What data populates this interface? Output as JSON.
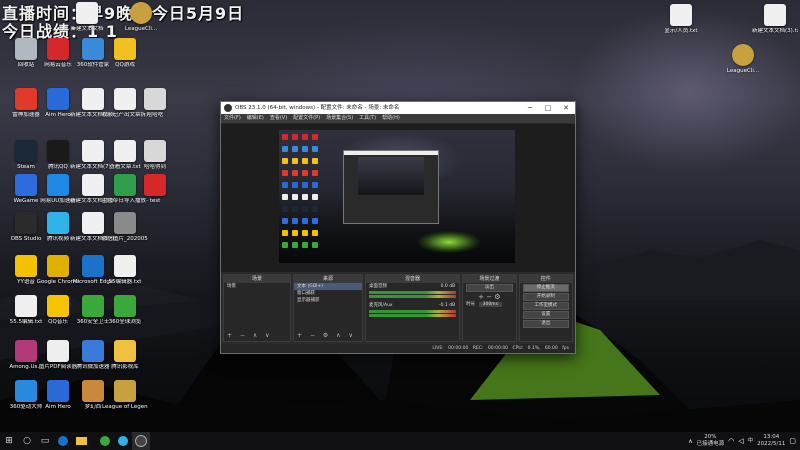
{
  "stream_overlay": {
    "line1": "直播时间：早9晚5  今日5月9日",
    "line2": "今日战绩：1 1"
  },
  "desktop_icons_left": [
    {
      "label": "回收站",
      "icon": "recycle-bin-icon",
      "color": "#b0b8c0"
    },
    {
      "label": "网易云音乐",
      "icon": "netease-music-icon",
      "color": "#d4282d"
    },
    {
      "label": "360软件管家",
      "icon": "360-software-icon",
      "color": "#3b8ad8"
    },
    {
      "label": "QQ游戏",
      "icon": "qq-game-icon",
      "color": "#f0c020"
    },
    {
      "label": "雷神加速器",
      "icon": "leishen-icon",
      "color": "#e23a2a"
    },
    {
      "label": "Aim Hero",
      "icon": "aim-hero-icon",
      "color": "#2a6ad8"
    },
    {
      "label": "新建文本文档(6).txt",
      "icon": "text-file-icon",
      "color": "#f0f0f0"
    },
    {
      "label": "视频已产出文章拆分.txt",
      "icon": "text-file-icon",
      "color": "#f0f0f0"
    },
    {
      "label": "哈哈吃",
      "icon": "app-icon",
      "color": "#d8d8d8"
    },
    {
      "label": "Steam",
      "icon": "steam-icon",
      "color": "#1b2838"
    },
    {
      "label": "腾讯QQ",
      "icon": "qq-icon",
      "color": "#1a1a1a"
    },
    {
      "label": "新建文本文档(7).txt",
      "icon": "text-file-icon",
      "color": "#f0f0f0"
    },
    {
      "label": "查看文章.txt",
      "icon": "text-file-icon",
      "color": "#f0f0f0"
    },
    {
      "label": "哈哈得到",
      "icon": "app-icon",
      "color": "#d8d8d8"
    },
    {
      "label": "WeGame",
      "icon": "wegame-icon",
      "color": "#2d6cdf"
    },
    {
      "label": "网易UU加速器",
      "icon": "uu-icon",
      "color": "#1e88e5"
    },
    {
      "label": "新建文本文档(8).txt",
      "icon": "text-file-icon",
      "color": "#f0f0f0"
    },
    {
      "label": "主播今日导入播放-360",
      "icon": "sheet-icon",
      "color": "#2e9e4a"
    },
    {
      "label": "test",
      "icon": "heart-icon",
      "color": "#d62828"
    },
    {
      "label": "OBS Studio",
      "icon": "obs-icon",
      "color": "#2b2b2b"
    },
    {
      "label": "腾讯视频",
      "icon": "tencent-video-icon",
      "color": "#2fb3e8"
    },
    {
      "label": "新建文本文档(5).txt",
      "icon": "text-file-icon",
      "color": "#f0f0f0"
    },
    {
      "label": "微信图片_2020051...",
      "icon": "image-file-icon",
      "color": "#8a8a8a"
    },
    {
      "label": "YY语音",
      "icon": "yy-icon",
      "color": "#f2c200"
    },
    {
      "label": "Google Chrome",
      "icon": "chrome-icon",
      "color": "#e0b000"
    },
    {
      "label": "Microsoft Edge",
      "icon": "edge-icon",
      "color": "#1a73c8"
    },
    {
      "label": "55编辑器.txt",
      "icon": "text-file-icon",
      "color": "#f0f0f0"
    },
    {
      "label": "55.5编辑.txt",
      "icon": "text-file-icon",
      "color": "#f0f0f0"
    },
    {
      "label": "QQ音乐",
      "icon": "qq-music-icon",
      "color": "#f5c400"
    },
    {
      "label": "360安全卫士",
      "icon": "360-safe-icon",
      "color": "#3aa83a"
    },
    {
      "label": "360全球浏览",
      "icon": "360-browser-icon",
      "color": "#3aa83a"
    },
    {
      "label": "Among.Us...",
      "icon": "archive-icon",
      "color": "#b33a7a"
    },
    {
      "label": "图片PDF阅读器",
      "icon": "pdf-icon",
      "color": "#eeeeee"
    },
    {
      "label": "腾讯微加速器",
      "icon": "accel-icon",
      "color": "#3a7ad8"
    },
    {
      "label": "腾讯影视库",
      "icon": "folder-icon",
      "color": "#f0c040"
    },
    {
      "label": "360驱动大师",
      "icon": "360-driver-icon",
      "color": "#2a8ae0"
    },
    {
      "label": "Aim Hero",
      "icon": "aim-hero-icon",
      "color": "#2a6ad8"
    },
    {
      "label": "梦幻西",
      "icon": "game-icon",
      "color": "#c88a3a"
    },
    {
      "label": "League of Legends",
      "icon": "lol-icon",
      "color": "#c8a040"
    }
  ],
  "desktop_icons_right": [
    {
      "label": "显示/人员.txt",
      "icon": "text-file-icon",
      "color": "#f0f0f0"
    },
    {
      "label": "新建文本文档(3).txt",
      "icon": "text-file-icon",
      "color": "#f0f0f0"
    },
    {
      "label": "LeagueCli...",
      "icon": "lol-icon",
      "color": "#c8a040"
    }
  ],
  "desktop_icons_top": [
    {
      "label": "新建文本文档",
      "icon": "text-file-icon",
      "color": "#f0f0f0"
    },
    {
      "label": "LeagueCli...",
      "icon": "lol-icon",
      "color": "#c8a040"
    }
  ],
  "obs": {
    "title": "OBS 23.1.0 (64-bit, windows) - 配置文件: 未命名 - 场景: 未命名",
    "minimize": "─",
    "maximize": "□",
    "close": "✕",
    "menu": [
      "文件(F)",
      "编辑(E)",
      "查看(V)",
      "配置文件(P)",
      "场景集合(S)",
      "工具(T)",
      "帮助(H)"
    ],
    "docks": {
      "scenes": {
        "title": "场景",
        "items": [
          "场景"
        ]
      },
      "sources": {
        "title": "来源",
        "items": [
          "文本 (GDI+)",
          "窗口捕获",
          "显示器捕获"
        ]
      },
      "mixer": {
        "title": "混音器",
        "channels": [
          {
            "name": "桌面音频",
            "value": "0.0 dB"
          },
          {
            "name": "麦克风/Aux",
            "value": "-0.1 dB"
          }
        ]
      },
      "transitions": {
        "title": "场景过渡",
        "type": "淡出",
        "duration_label": "时长",
        "duration": "300ms"
      },
      "controls": {
        "title": "控件",
        "buttons": [
          "停止推流",
          "开始录制",
          "工作室模式",
          "设置",
          "退出"
        ]
      }
    },
    "status": {
      "live": "LIVE: 00:00:00",
      "rec": "REC: 00:00:00",
      "cpu": "CPU: 0.1%, 60.00 fps"
    }
  },
  "taskbar": {
    "start": "⊞",
    "battery": "20%",
    "battery_status": "已接通电源",
    "time": "13:04",
    "date": "2022/5/11",
    "lang": "中"
  }
}
